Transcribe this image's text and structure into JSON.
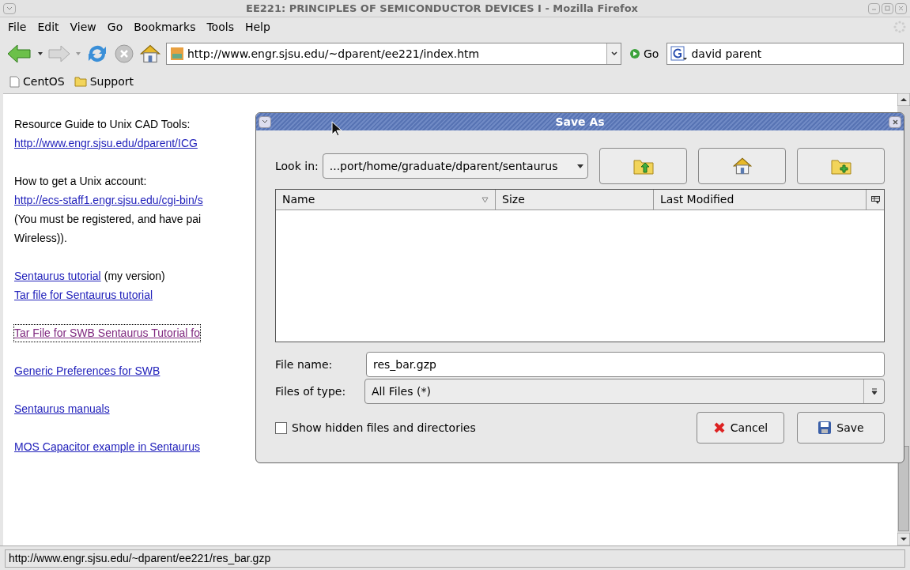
{
  "window": {
    "title": "EE221: PRINCIPLES OF SEMICONDUCTOR DEVICES I - Mozilla Firefox"
  },
  "menu": [
    "File",
    "Edit",
    "View",
    "Go",
    "Bookmarks",
    "Tools",
    "Help"
  ],
  "toolbar": {
    "url": "http://www.engr.sjsu.edu/~dparent/ee221/index.htm",
    "go": "Go",
    "search": "david parent"
  },
  "bookmarks": [
    {
      "label": "CentOS",
      "kind": "page"
    },
    {
      "label": "Support",
      "kind": "folder"
    }
  ],
  "page": {
    "paragraphs": [
      [
        {
          "focused": false,
          "segments": [
            {
              "text": "Resource Guide to Unix CAD Tools:",
              "kind": "text"
            }
          ]
        },
        {
          "focused": false,
          "segments": [
            {
              "text": "http://www.engr.sjsu.edu/dparent/ICG",
              "kind": "link"
            }
          ]
        }
      ],
      [
        {
          "focused": false,
          "segments": [
            {
              "text": "How to get a Unix account:",
              "kind": "text"
            }
          ]
        },
        {
          "focused": false,
          "segments": [
            {
              "text": "http://ecs-staff1.engr.sjsu.edu/cgi-bin/s",
              "kind": "link"
            }
          ]
        },
        {
          "focused": false,
          "segments": [
            {
              "text": "(You must be registered, and have pai",
              "kind": "text"
            }
          ]
        },
        {
          "focused": false,
          "segments": [
            {
              "text": "Wireless)).",
              "kind": "text"
            }
          ]
        }
      ],
      [
        {
          "focused": false,
          "segments": [
            {
              "text": "Sentaurus tutorial",
              "kind": "link"
            },
            {
              "text": "(my version)",
              "kind": "text"
            }
          ]
        },
        {
          "focused": false,
          "segments": [
            {
              "text": "Tar file for Sentaurus tutorial",
              "kind": "link"
            }
          ]
        }
      ],
      [
        {
          "focused": true,
          "segments": [
            {
              "text": "Tar File for SWB Sentaurus Tutorial fo",
              "kind": "visited"
            }
          ]
        }
      ],
      [
        {
          "focused": false,
          "segments": [
            {
              "text": "Generic Preferences for SWB",
              "kind": "link"
            }
          ]
        }
      ],
      [
        {
          "focused": false,
          "segments": [
            {
              "text": "Sentaurus manuals",
              "kind": "link"
            }
          ]
        }
      ],
      [
        {
          "focused": false,
          "segments": [
            {
              "text": "MOS Capacitor example in Sentaurus",
              "kind": "link"
            }
          ]
        }
      ]
    ]
  },
  "dialog": {
    "title": "Save As",
    "look_in": {
      "label": "Look in:",
      "value": "...port/home/graduate/dparent/sentaurus"
    },
    "columns": [
      {
        "label": "Name",
        "sorted": true
      },
      {
        "label": "Size",
        "sorted": false
      },
      {
        "label": "Last Modified",
        "sorted": false
      }
    ],
    "file_name": {
      "label": "File name:",
      "value": "res_bar.gzp"
    },
    "file_type": {
      "label": "Files of type:",
      "value": "All Files (*)"
    },
    "show_hidden": {
      "label": "Show hidden files and directories",
      "checked": false
    },
    "buttons": [
      {
        "label": "Cancel",
        "kind": "cancel"
      },
      {
        "label": "Save",
        "kind": "save"
      }
    ]
  },
  "status_bar": {
    "text": "http://www.engr.sjsu.edu/~dparent/ee221/res_bar.gzp"
  }
}
